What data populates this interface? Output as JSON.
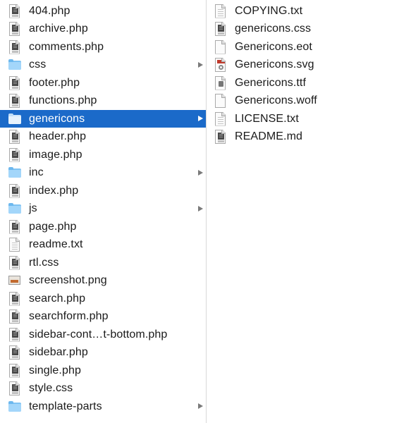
{
  "left_column": {
    "selected_index": 6,
    "items": [
      {
        "name": "404.php",
        "kind": "code",
        "icon": "php-file-icon",
        "has_children": false
      },
      {
        "name": "archive.php",
        "kind": "code",
        "icon": "php-file-icon",
        "has_children": false
      },
      {
        "name": "comments.php",
        "kind": "code",
        "icon": "php-file-icon",
        "has_children": false
      },
      {
        "name": "css",
        "kind": "folder",
        "icon": "folder-icon",
        "has_children": true
      },
      {
        "name": "footer.php",
        "kind": "code",
        "icon": "php-file-icon",
        "has_children": false
      },
      {
        "name": "functions.php",
        "kind": "code",
        "icon": "php-file-icon",
        "has_children": false
      },
      {
        "name": "genericons",
        "kind": "folder",
        "icon": "folder-icon",
        "has_children": true
      },
      {
        "name": "header.php",
        "kind": "code",
        "icon": "php-file-icon",
        "has_children": false
      },
      {
        "name": "image.php",
        "kind": "code",
        "icon": "php-file-icon",
        "has_children": false
      },
      {
        "name": "inc",
        "kind": "folder",
        "icon": "folder-icon",
        "has_children": true
      },
      {
        "name": "index.php",
        "kind": "code",
        "icon": "php-file-icon",
        "has_children": false
      },
      {
        "name": "js",
        "kind": "folder",
        "icon": "folder-icon",
        "has_children": true
      },
      {
        "name": "page.php",
        "kind": "code",
        "icon": "php-file-icon",
        "has_children": false
      },
      {
        "name": "readme.txt",
        "kind": "text",
        "icon": "text-file-icon",
        "has_children": false
      },
      {
        "name": "rtl.css",
        "kind": "code",
        "icon": "css-file-icon",
        "has_children": false
      },
      {
        "name": "screenshot.png",
        "kind": "image",
        "icon": "png-image-icon",
        "has_children": false
      },
      {
        "name": "search.php",
        "kind": "code",
        "icon": "php-file-icon",
        "has_children": false
      },
      {
        "name": "searchform.php",
        "kind": "code",
        "icon": "php-file-icon",
        "has_children": false
      },
      {
        "name": "sidebar-cont…t-bottom.php",
        "kind": "code",
        "icon": "php-file-icon",
        "has_children": false
      },
      {
        "name": "sidebar.php",
        "kind": "code",
        "icon": "php-file-icon",
        "has_children": false
      },
      {
        "name": "single.php",
        "kind": "code",
        "icon": "php-file-icon",
        "has_children": false
      },
      {
        "name": "style.css",
        "kind": "code",
        "icon": "css-file-icon",
        "has_children": false
      },
      {
        "name": "template-parts",
        "kind": "folder",
        "icon": "folder-icon",
        "has_children": true
      }
    ]
  },
  "right_column": {
    "items": [
      {
        "name": "COPYING.txt",
        "kind": "text",
        "icon": "text-file-icon"
      },
      {
        "name": "genericons.css",
        "kind": "code",
        "icon": "css-file-icon"
      },
      {
        "name": "Genericons.eot",
        "kind": "blank",
        "icon": "eot-file-icon"
      },
      {
        "name": "Genericons.svg",
        "kind": "svg",
        "icon": "svg-file-icon"
      },
      {
        "name": "Genericons.ttf",
        "kind": "ttf",
        "icon": "ttf-font-icon"
      },
      {
        "name": "Genericons.woff",
        "kind": "blank",
        "icon": "woff-file-icon"
      },
      {
        "name": "LICENSE.txt",
        "kind": "text",
        "icon": "text-file-icon"
      },
      {
        "name": "README.md",
        "kind": "code",
        "icon": "md-file-icon"
      }
    ]
  },
  "colors": {
    "selection": "#1b6ac9",
    "folder": "#a3d6fa",
    "divider": "#d9d9d9",
    "disclosure_arrow": "#7b7b7b"
  }
}
